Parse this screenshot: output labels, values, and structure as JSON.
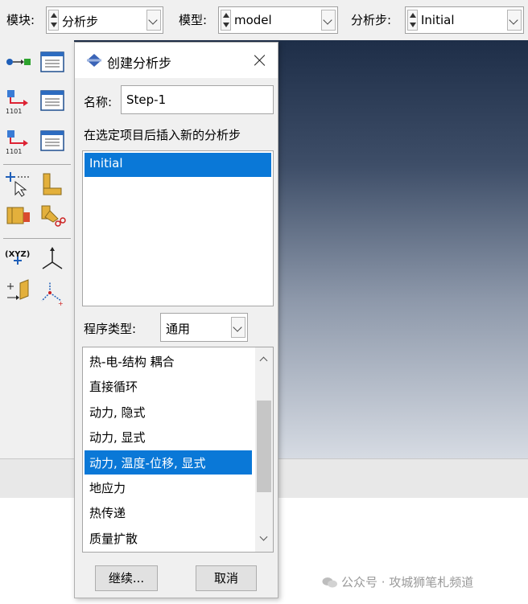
{
  "context_bar": {
    "module": {
      "label": "模块:",
      "value": "分析步"
    },
    "model": {
      "label": "模型:",
      "value": "model"
    },
    "step": {
      "label": "分析步:",
      "value": "Initial"
    }
  },
  "toolbox": {
    "tools": [
      "step-create-icon",
      "step-manager-icon",
      "field-output-create-icon",
      "field-output-manager-icon",
      "history-output-create-icon",
      "history-output-manager-icon",
      "query-select-icon",
      "section-icon",
      "partition-icon",
      "cut-partition-icon",
      "datum-point-icon",
      "datum-axis-icon",
      "datum-plane-icon",
      "datum-csys-icon"
    ]
  },
  "dialog": {
    "title": "创建分析步",
    "name_label": "名称:",
    "name_value": "Step-1",
    "insert_label": "在选定项目后插入新的分析步",
    "existing_steps": [
      {
        "label": "Initial",
        "selected": true
      }
    ],
    "procedure_label": "程序类型:",
    "procedure_type": "通用",
    "procedures": [
      {
        "label": "热-电-结构 耦合",
        "selected": false
      },
      {
        "label": "直接循环",
        "selected": false
      },
      {
        "label": "动力, 隐式",
        "selected": false
      },
      {
        "label": "动力, 显式",
        "selected": false
      },
      {
        "label": "动力, 温度-位移, 显式",
        "selected": true
      },
      {
        "label": "地应力",
        "selected": false
      },
      {
        "label": "热传递",
        "selected": false
      },
      {
        "label": "质量扩散",
        "selected": false
      }
    ],
    "scroll_position": 0.45,
    "continue_label": "继续...",
    "cancel_label": "取消"
  },
  "watermark": {
    "text": "公众号 · 攻城狮笔札频道"
  },
  "colors": {
    "selection": "#0a78d7",
    "viewport_top": "#1e2e48",
    "viewport_bottom": "#d6dbe3"
  }
}
